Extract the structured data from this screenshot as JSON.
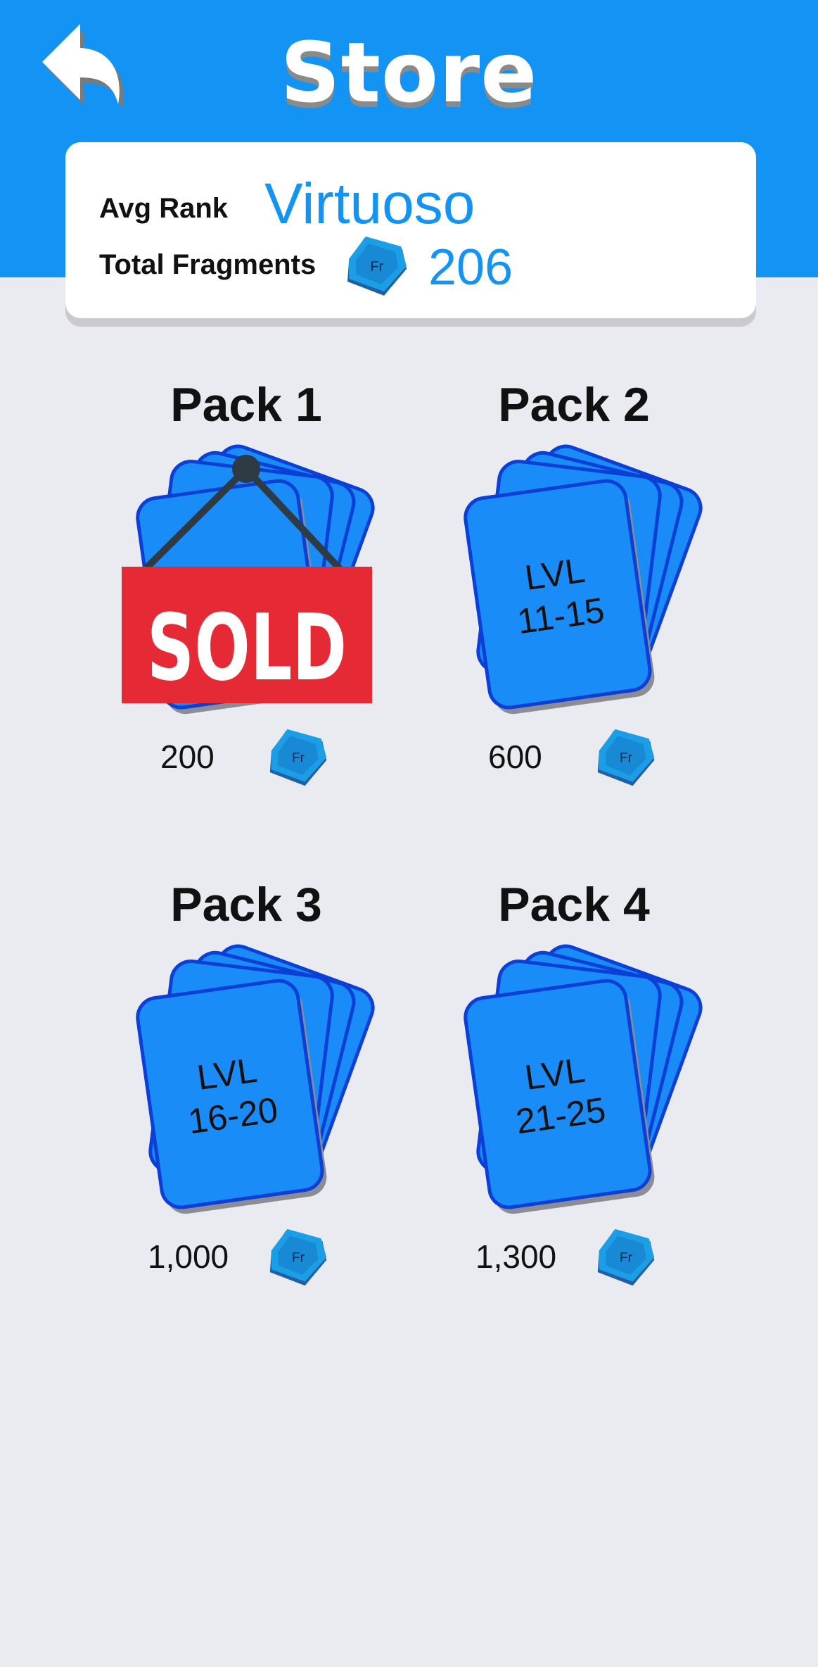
{
  "header": {
    "title": "Store",
    "back_icon": "back-arrow-icon",
    "color": "#1394f5"
  },
  "stats": {
    "avg_rank_label": "Avg Rank",
    "avg_rank_value": "Virtuoso",
    "fragments_label": "Total Fragments",
    "fragments_value": "206",
    "fragment_icon_text": "Fr"
  },
  "packs": [
    {
      "title": "Pack 1",
      "price": "200",
      "card_text_line1": "",
      "card_text_line2": "",
      "sold": true,
      "sold_label": "SOLD"
    },
    {
      "title": "Pack 2",
      "price": "600",
      "card_text_line1": "LVL",
      "card_text_line2": "11-15",
      "sold": false
    },
    {
      "title": "Pack 3",
      "price": "1,000",
      "card_text_line1": "LVL",
      "card_text_line2": "16-20",
      "sold": false
    },
    {
      "title": "Pack 4",
      "price": "1,300",
      "card_text_line1": "LVL",
      "card_text_line2": "21-25",
      "sold": false
    }
  ],
  "colors": {
    "card_fill": "#1a8cf7",
    "card_stroke": "#0b3fd6",
    "sold_red": "#e62a35",
    "background": "#e9ebf0"
  }
}
